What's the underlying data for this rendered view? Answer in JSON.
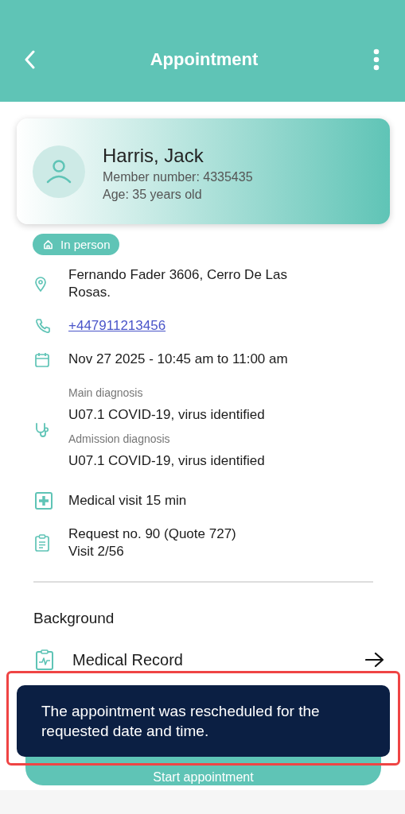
{
  "header": {
    "title": "Appointment"
  },
  "patient": {
    "name": "Harris, Jack",
    "member": "Member number: 4335435",
    "age": "Age: 35 years old"
  },
  "mode_badge": "In person",
  "details": [
    {
      "kind": "location",
      "lines": [
        "Fernando Fader 3606, Cerro De Las Rosas."
      ]
    },
    {
      "kind": "phone",
      "link": "+447911213456"
    },
    {
      "kind": "calendar",
      "lines": [
        "Nov 27 2025 - 10:45 am to 11:00 am"
      ]
    },
    {
      "kind": "diagnosis",
      "groups": [
        {
          "label": "Main diagnosis",
          "value": "U07.1 COVID-19, virus identified"
        },
        {
          "label": "Admission diagnosis",
          "value": "U07.1 COVID-19, virus identified"
        }
      ]
    },
    {
      "kind": "visit",
      "lines": [
        "Medical visit 15 min"
      ]
    },
    {
      "kind": "request",
      "lines": [
        "Request no. 90 (Quote 727)",
        "Visit 2/56"
      ]
    }
  ],
  "background": {
    "title": "Background",
    "items": [
      {
        "label": "Medical Record"
      }
    ]
  },
  "primary_button": "Start appointment",
  "toast": {
    "message": "The appointment was rescheduled for the requested date and time.",
    "highlighted": true
  }
}
